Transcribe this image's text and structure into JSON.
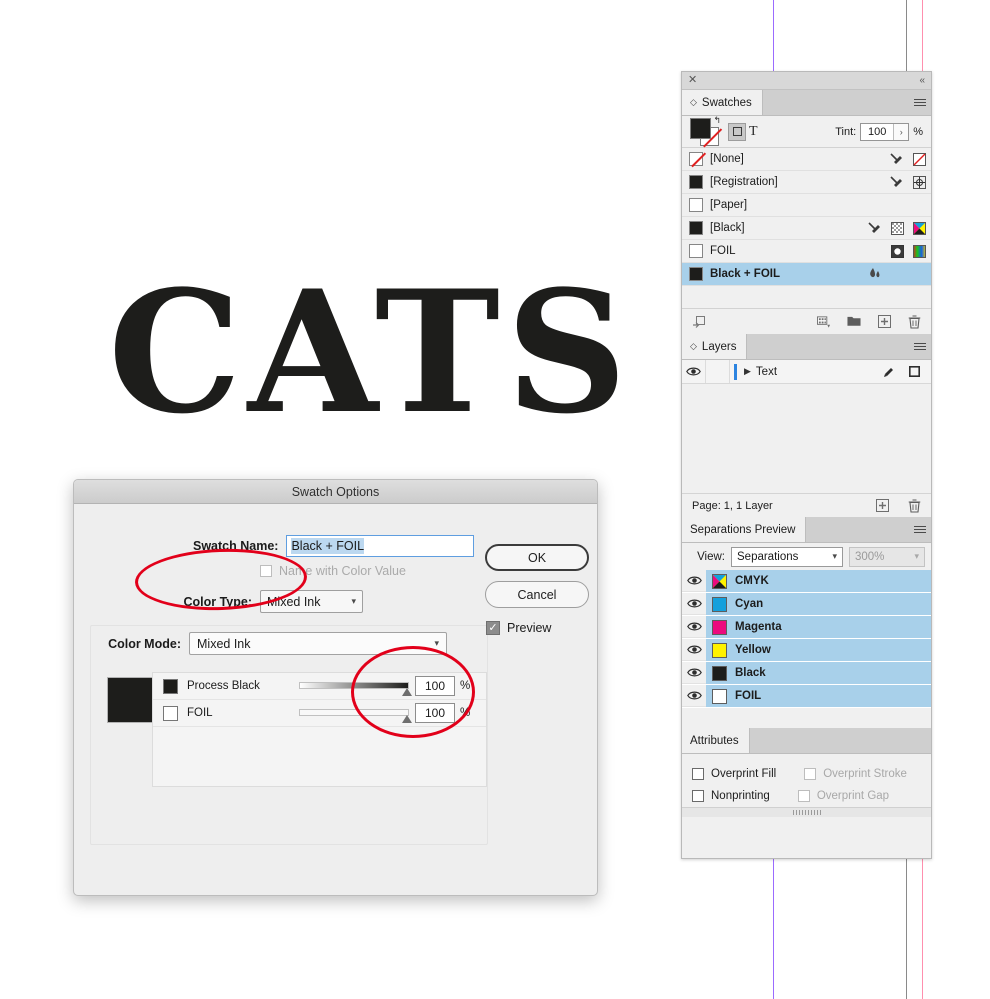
{
  "canvas": {
    "artwork_text": "CATS",
    "guides": [
      "violet-guide",
      "gray-guide",
      "pink-guide"
    ]
  },
  "dock": {
    "close_icon": "close-icon",
    "collapse_icon": "collapse-panel-icon"
  },
  "swatches": {
    "tab_label": "Swatches",
    "tint_label": "Tint:",
    "tint_value": "100",
    "percent": "%",
    "fill_color": "#1d1d1b",
    "stroke_color": "#ffffff",
    "selected_swatch": "Black + FOIL",
    "highlight_color": "#a8d0ea",
    "items": [
      {
        "name": "[None]",
        "chip": "none",
        "icons": [
          "ink-drop-slash-icon",
          "none-square-icon"
        ]
      },
      {
        "name": "[Registration]",
        "chip": "#1d1d1b",
        "icons": [
          "ink-drop-slash-icon",
          "registration-icon"
        ]
      },
      {
        "name": "[Paper]",
        "chip": "#ffffff",
        "icons": []
      },
      {
        "name": "[Black]",
        "chip": "#1d1d1b",
        "icons": [
          "ink-drop-slash-icon",
          "tint-grid-icon",
          "cmyk-icon"
        ]
      },
      {
        "name": "FOIL",
        "chip": "#ffffff",
        "icons": [
          "spot-color-icon",
          "rgb-icon"
        ]
      },
      {
        "name": "Black + FOIL",
        "chip": "#1d1d1b",
        "icons": [
          "mixed-ink-icon"
        ],
        "selected": true
      }
    ],
    "footer_icons": [
      "show-all-swatches-icon",
      "new-color-group-icon",
      "new-swatch-folder-icon",
      "new-swatch-icon",
      "delete-swatch-icon"
    ]
  },
  "layers": {
    "tab_label": "Layers",
    "eye_icon": "eye-icon",
    "layer_name": "Text",
    "expand_icon": "chevron-right-icon",
    "pen_icon": "pen-icon",
    "target_icon": "target-square-icon",
    "status": "Page: 1, 1 Layer",
    "footer_icons": [
      "new-layer-icon",
      "delete-layer-icon"
    ]
  },
  "separations": {
    "tab_label": "Separations Preview",
    "view_label": "View:",
    "view_value": "Separations",
    "zoom_value": "300%",
    "rows": [
      {
        "name": "CMYK",
        "chip": "cmyk",
        "visible": true
      },
      {
        "name": "Cyan",
        "chip": "#14a0dc",
        "visible": true
      },
      {
        "name": "Magenta",
        "chip": "#ec0a7e",
        "visible": true
      },
      {
        "name": "Yellow",
        "chip": "#fff200",
        "visible": true
      },
      {
        "name": "Black",
        "chip": "#1d1d1b",
        "visible": true
      },
      {
        "name": "FOIL",
        "chip": "#ffffff",
        "visible": true
      }
    ]
  },
  "attributes": {
    "tab_label": "Attributes",
    "options": [
      {
        "label": "Overprint Fill",
        "checked": false,
        "disabled": false
      },
      {
        "label": "Overprint Stroke",
        "checked": false,
        "disabled": true
      },
      {
        "label": "Nonprinting",
        "checked": false,
        "disabled": false
      },
      {
        "label": "Overprint Gap",
        "checked": false,
        "disabled": true
      }
    ]
  },
  "dialog": {
    "title": "Swatch Options",
    "swatch_name_label": "Swatch Name:",
    "swatch_name_value": "Black + FOIL",
    "name_with_color_value_label": "Name with Color Value",
    "color_type_label": "Color Type:",
    "color_type_value": "Mixed Ink",
    "color_mode_label": "Color Mode:",
    "color_mode_value": "Mixed Ink",
    "ok_label": "OK",
    "cancel_label": "Cancel",
    "preview_label": "Preview",
    "preview_checked": true,
    "preview_swatch_color": "#1d1d1b",
    "inks": [
      {
        "name": "Process Black",
        "chip": "#1d1d1b",
        "value": "100",
        "unit": "%"
      },
      {
        "name": "FOIL",
        "chip": "#ffffff",
        "value": "100",
        "unit": "%"
      }
    ]
  },
  "annotations": {
    "color": "#e2001a",
    "shapes": [
      "ellipse-around-color-type",
      "ellipse-around-ink-values"
    ]
  }
}
